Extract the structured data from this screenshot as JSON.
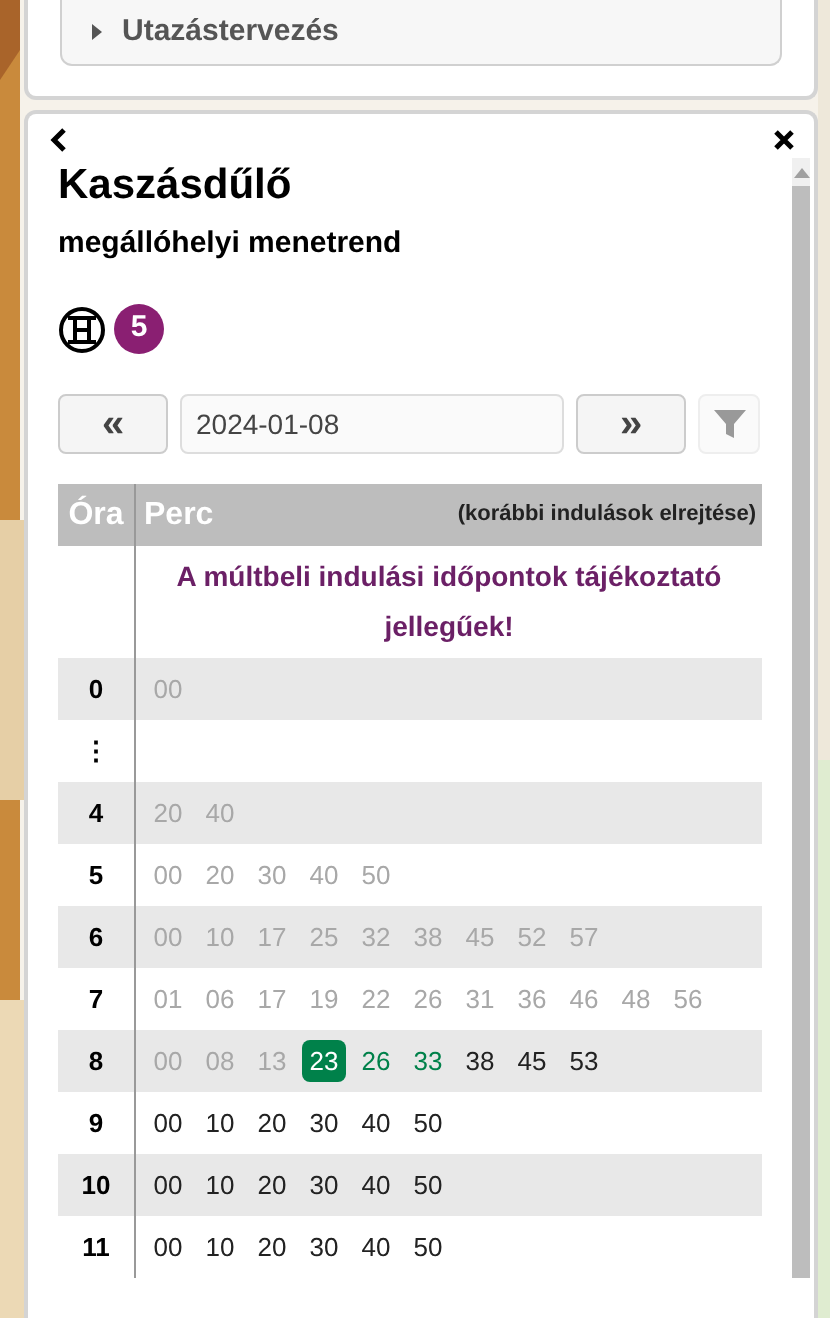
{
  "accordion": {
    "label": "Utazástervezés",
    "expanded": false
  },
  "panel": {
    "title": "Kaszásdűlő",
    "subtitle": "megállóhelyi menetrend",
    "route": {
      "number": "5",
      "color": "#8a1f72"
    }
  },
  "date_nav": {
    "prev": "«",
    "date": "2024-01-08",
    "next": "»"
  },
  "table": {
    "columns": [
      "Óra",
      "Perc"
    ],
    "hide_link": "(korábbi indulások elrejtése)",
    "notice": "A múltbeli indulási időpontok tájékoztató jellegűek!",
    "rows": [
      {
        "hour": "0",
        "minutes": [
          {
            "text": "00",
            "kind": "past"
          }
        ]
      },
      {
        "hour": "⋮",
        "minutes": []
      },
      {
        "hour": "4",
        "minutes": [
          {
            "text": "20",
            "kind": "past"
          },
          {
            "text": "40",
            "kind": "past"
          }
        ]
      },
      {
        "hour": "5",
        "minutes": [
          {
            "text": "00",
            "kind": "past"
          },
          {
            "text": "20",
            "kind": "past"
          },
          {
            "text": "30",
            "kind": "past"
          },
          {
            "text": "40",
            "kind": "past"
          },
          {
            "text": "50",
            "kind": "past"
          }
        ]
      },
      {
        "hour": "6",
        "minutes": [
          {
            "text": "00",
            "kind": "past"
          },
          {
            "text": "10",
            "kind": "past"
          },
          {
            "text": "17",
            "kind": "past"
          },
          {
            "text": "25",
            "kind": "past"
          },
          {
            "text": "32",
            "kind": "past"
          },
          {
            "text": "38",
            "kind": "past"
          },
          {
            "text": "45",
            "kind": "past"
          },
          {
            "text": "52",
            "kind": "past"
          },
          {
            "text": "57",
            "kind": "past"
          }
        ]
      },
      {
        "hour": "7",
        "minutes": [
          {
            "text": "01",
            "kind": "past"
          },
          {
            "text": "06",
            "kind": "past"
          },
          {
            "text": "17",
            "kind": "past"
          },
          {
            "text": "19",
            "kind": "past"
          },
          {
            "text": "22",
            "kind": "past"
          },
          {
            "text": "26",
            "kind": "past"
          },
          {
            "text": "31",
            "kind": "past"
          },
          {
            "text": "36",
            "kind": "past"
          },
          {
            "text": "46",
            "kind": "past"
          },
          {
            "text": "48",
            "kind": "past"
          },
          {
            "text": "56",
            "kind": "past"
          }
        ]
      },
      {
        "hour": "8",
        "minutes": [
          {
            "text": "00",
            "kind": "past"
          },
          {
            "text": "08",
            "kind": "past"
          },
          {
            "text": "13",
            "kind": "past"
          },
          {
            "text": "23",
            "kind": "next"
          },
          {
            "text": "26",
            "kind": "soon"
          },
          {
            "text": "33",
            "kind": "soon"
          },
          {
            "text": "38",
            "kind": "future"
          },
          {
            "text": "45",
            "kind": "future"
          },
          {
            "text": "53",
            "kind": "future"
          }
        ]
      },
      {
        "hour": "9",
        "minutes": [
          {
            "text": "00",
            "kind": "future"
          },
          {
            "text": "10",
            "kind": "future"
          },
          {
            "text": "20",
            "kind": "future"
          },
          {
            "text": "30",
            "kind": "future"
          },
          {
            "text": "40",
            "kind": "future"
          },
          {
            "text": "50",
            "kind": "future"
          }
        ]
      },
      {
        "hour": "10",
        "minutes": [
          {
            "text": "00",
            "kind": "future"
          },
          {
            "text": "10",
            "kind": "future"
          },
          {
            "text": "20",
            "kind": "future"
          },
          {
            "text": "30",
            "kind": "future"
          },
          {
            "text": "40",
            "kind": "future"
          },
          {
            "text": "50",
            "kind": "future"
          }
        ]
      },
      {
        "hour": "11",
        "minutes": [
          {
            "text": "00",
            "kind": "future"
          },
          {
            "text": "10",
            "kind": "future"
          },
          {
            "text": "20",
            "kind": "future"
          },
          {
            "text": "30",
            "kind": "future"
          },
          {
            "text": "40",
            "kind": "future"
          },
          {
            "text": "50",
            "kind": "future"
          }
        ]
      }
    ]
  }
}
